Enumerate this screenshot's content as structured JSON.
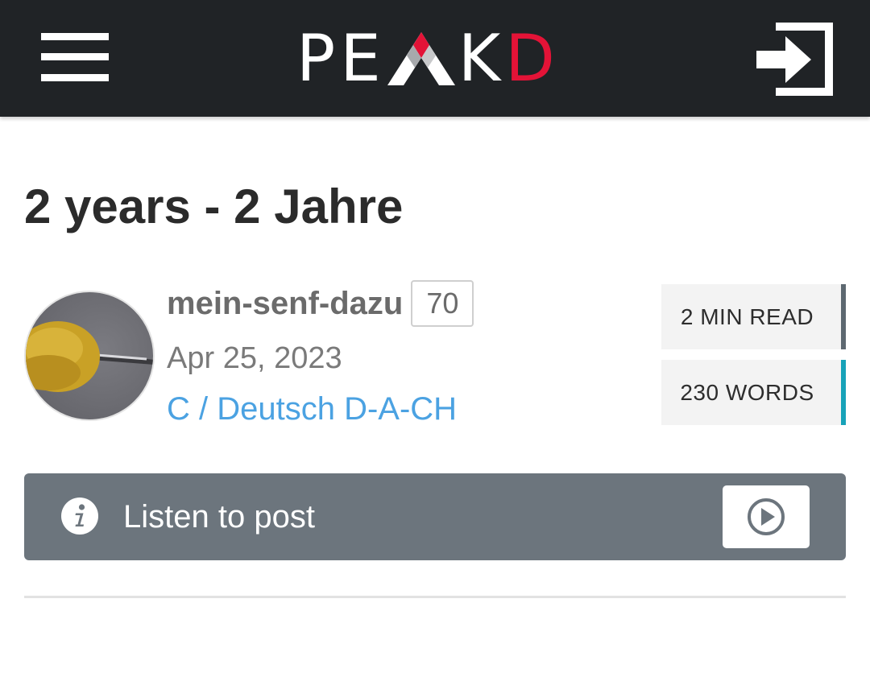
{
  "header": {
    "logo_text": [
      "P",
      "E",
      "K",
      "D"
    ],
    "logo_alt": "PEAKD",
    "menu_icon": "hamburger-menu-icon",
    "login_icon": "sign-in-icon",
    "colors": {
      "background": "#202326",
      "logo_accent": "#e31337"
    }
  },
  "post": {
    "title": "2 years - 2 Jahre",
    "author": "mein-senf-dazu",
    "reputation": "70",
    "date": "Apr 25, 2023",
    "community": "C / Deutsch D-A-CH",
    "stats": {
      "read_time": "2 MIN READ",
      "words": "230 WORDS"
    }
  },
  "listen": {
    "label": "Listen to post",
    "info_icon": "info-icon",
    "play_icon": "play-circle-icon",
    "bar_color": "#6c757d"
  },
  "colors": {
    "link": "#4ba2e2",
    "stat_read_border": "#5d6870",
    "stat_words_border": "#17a2b8"
  }
}
